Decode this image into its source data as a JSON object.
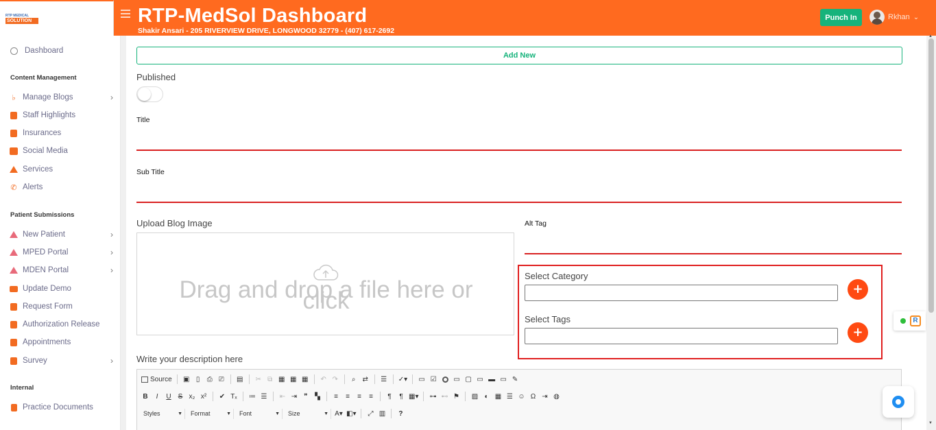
{
  "logo": {
    "line1": "RTP MEDICAL",
    "line2": "SOLUTION"
  },
  "header": {
    "title": "RTP-MedSol Dashboard",
    "subtitle": "Shakir Ansari - 205 RIVERVIEW DRIVE, LONGWOOD 32779 - (407) 617-2692",
    "punch_label": "Punch In",
    "user_name": "Rkhan",
    "accent_color": "#ff6a1f",
    "punch_color": "#16b37b"
  },
  "sidebar": {
    "dashboard": "Dashboard",
    "section_content": "Content Management",
    "content_items": [
      {
        "label": "Manage Blogs",
        "icon": "blog-icon",
        "has_arrow": true
      },
      {
        "label": "Staff Highlights",
        "icon": "staff-icon"
      },
      {
        "label": "Insurances",
        "icon": "insurance-icon"
      },
      {
        "label": "Social Media",
        "icon": "social-media-icon"
      },
      {
        "label": "Services",
        "icon": "services-icon"
      },
      {
        "label": "Alerts",
        "icon": "phone-icon"
      }
    ],
    "section_patient": "Patient Submissions",
    "patient_items": [
      {
        "label": "New Patient",
        "icon": "home-icon",
        "has_arrow": true
      },
      {
        "label": "MPED Portal",
        "icon": "home-icon",
        "has_arrow": true
      },
      {
        "label": "MDEN Portal",
        "icon": "home-icon",
        "has_arrow": true
      },
      {
        "label": "Update Demo",
        "icon": "id-card-icon"
      },
      {
        "label": "Request Form",
        "icon": "form-icon"
      },
      {
        "label": "Authorization Release",
        "icon": "check-icon"
      },
      {
        "label": "Appointments",
        "icon": "calendar-icon"
      },
      {
        "label": "Survey",
        "icon": "chart-icon",
        "has_arrow": true
      }
    ],
    "section_internal": "Internal",
    "internal_items": [
      {
        "label": "Practice Documents",
        "icon": "clipboard-icon"
      }
    ]
  },
  "form": {
    "add_new": "Add New",
    "published": "Published",
    "title": "Title",
    "sub_title": "Sub Title",
    "upload_label": "Upload Blog Image",
    "upload_text_1": "Drag and drop a file here or",
    "upload_text_2": "click",
    "alt_tag": "Alt Tag",
    "select_category": "Select Category",
    "select_tags": "Select Tags",
    "description": "Write your description here"
  },
  "editor": {
    "source": "Source",
    "styles": "Styles",
    "format": "Format",
    "font": "Font",
    "size": "Size"
  }
}
